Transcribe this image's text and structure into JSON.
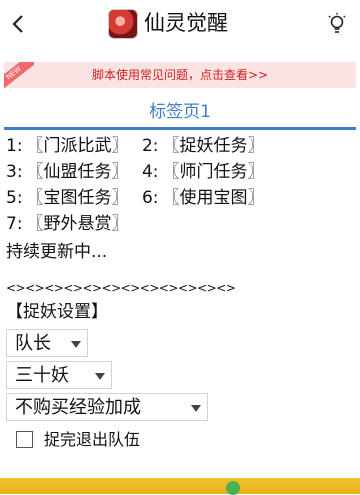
{
  "header": {
    "title": "仙灵觉醒"
  },
  "notice": {
    "badge": "NEW",
    "text": "脚本使用常见问题，点击查看>>"
  },
  "tab": {
    "label": "标签页1"
  },
  "tasks": [
    {
      "index": "1:",
      "name": "〖门派比武〗"
    },
    {
      "index": "2:",
      "name": "〖捉妖任务〗"
    },
    {
      "index": "3:",
      "name": "〖仙盟任务〗"
    },
    {
      "index": "4:",
      "name": "〖师门任务〗"
    },
    {
      "index": "5:",
      "name": "〖宝图任务〗"
    },
    {
      "index": "6:",
      "name": "〖使用宝图〗"
    },
    {
      "index": "7:",
      "name": "〖野外悬赏〗"
    }
  ],
  "update_text": "持续更新中...",
  "separator": "<><><><><><><><><><><><>",
  "section_title": "【捉妖设置】",
  "selects": {
    "role": "队长",
    "count": "三十妖",
    "exp": "不购买经验加成"
  },
  "checkbox": {
    "label": "捉完退出队伍",
    "checked": false
  },
  "colors": {
    "accent": "#3b7ec9",
    "notice_text": "#d11f1f",
    "notice_bg": "#fbe3e3",
    "bottom_bar": "#f2c230"
  }
}
